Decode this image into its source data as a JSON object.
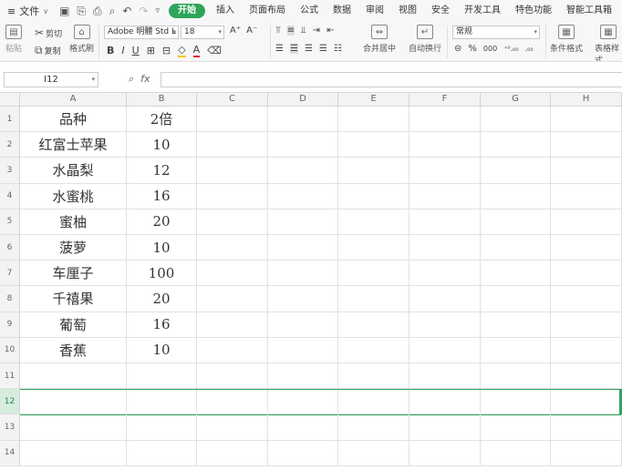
{
  "menubar": {
    "file_label": "文件",
    "tabs": [
      "开始",
      "插入",
      "页面布局",
      "公式",
      "数据",
      "审阅",
      "视图",
      "安全",
      "开发工具",
      "特色功能",
      "智能工具箱"
    ],
    "active_tab": "开始"
  },
  "ribbon": {
    "paste": "粘贴",
    "cut": "剪切",
    "copy": "复制",
    "format_painter": "格式刷",
    "font_name": "Adobe 明體 Std L",
    "font_size": "18",
    "number_format": "常规",
    "merge_center": "合并居中",
    "wrap_text": "自动换行",
    "conditional_format": "条件格式",
    "table_style": "表格样式",
    "bold": "B",
    "italic": "I",
    "underline": "U",
    "percent": "%",
    "thousands": "000"
  },
  "formula_bar": {
    "cell_ref": "I12",
    "fx": "fx",
    "content": ""
  },
  "sheet": {
    "columns": [
      "A",
      "B",
      "C",
      "D",
      "E",
      "F",
      "G",
      "H"
    ],
    "rows": [
      "1",
      "2",
      "3",
      "4",
      "5",
      "6",
      "7",
      "8",
      "9",
      "10",
      "11",
      "12",
      "13",
      "14"
    ],
    "selected_row": "12",
    "cells": [
      [
        "品种",
        "2倍"
      ],
      [
        "红富士苹果",
        "10"
      ],
      [
        "水晶梨",
        "12"
      ],
      [
        "水蜜桃",
        "16"
      ],
      [
        "蜜柚",
        "20"
      ],
      [
        "菠萝",
        "10"
      ],
      [
        "车厘子",
        "100"
      ],
      [
        "千禧果",
        "20"
      ],
      [
        "葡萄",
        "16"
      ],
      [
        "香蕉",
        "10"
      ]
    ]
  }
}
